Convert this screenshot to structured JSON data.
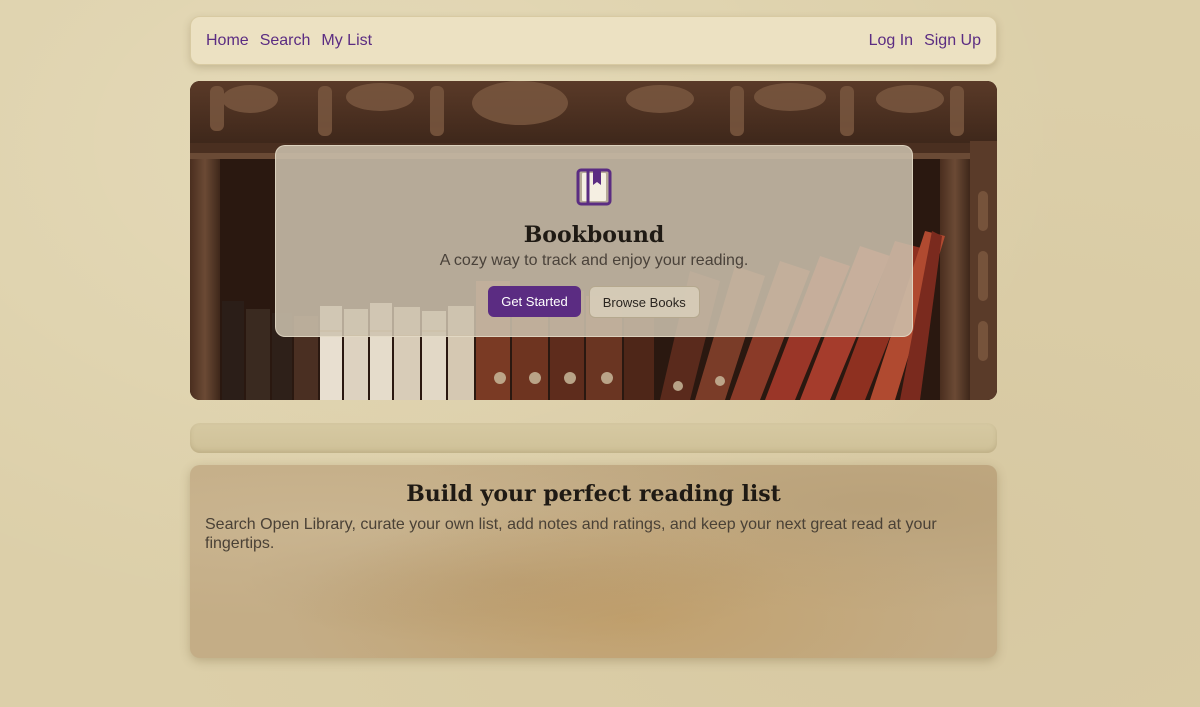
{
  "nav": {
    "left": [
      "Home",
      "Search",
      "My List"
    ],
    "right": [
      "Log In",
      "Sign Up"
    ]
  },
  "hero": {
    "title": "Bookbound",
    "subtitle": "A cozy way to track and enjoy your reading.",
    "primary_button": "Get Started",
    "secondary_button": "Browse Books",
    "icon": "book-icon"
  },
  "feature": {
    "title": "Build your perfect reading list",
    "text": "Search Open Library, curate your own list, add notes and ratings, and keep your next great read at your fingertips."
  },
  "colors": {
    "accent": "#5b2c82",
    "background": "#dccfa9",
    "navbar": "#ece1c2"
  }
}
